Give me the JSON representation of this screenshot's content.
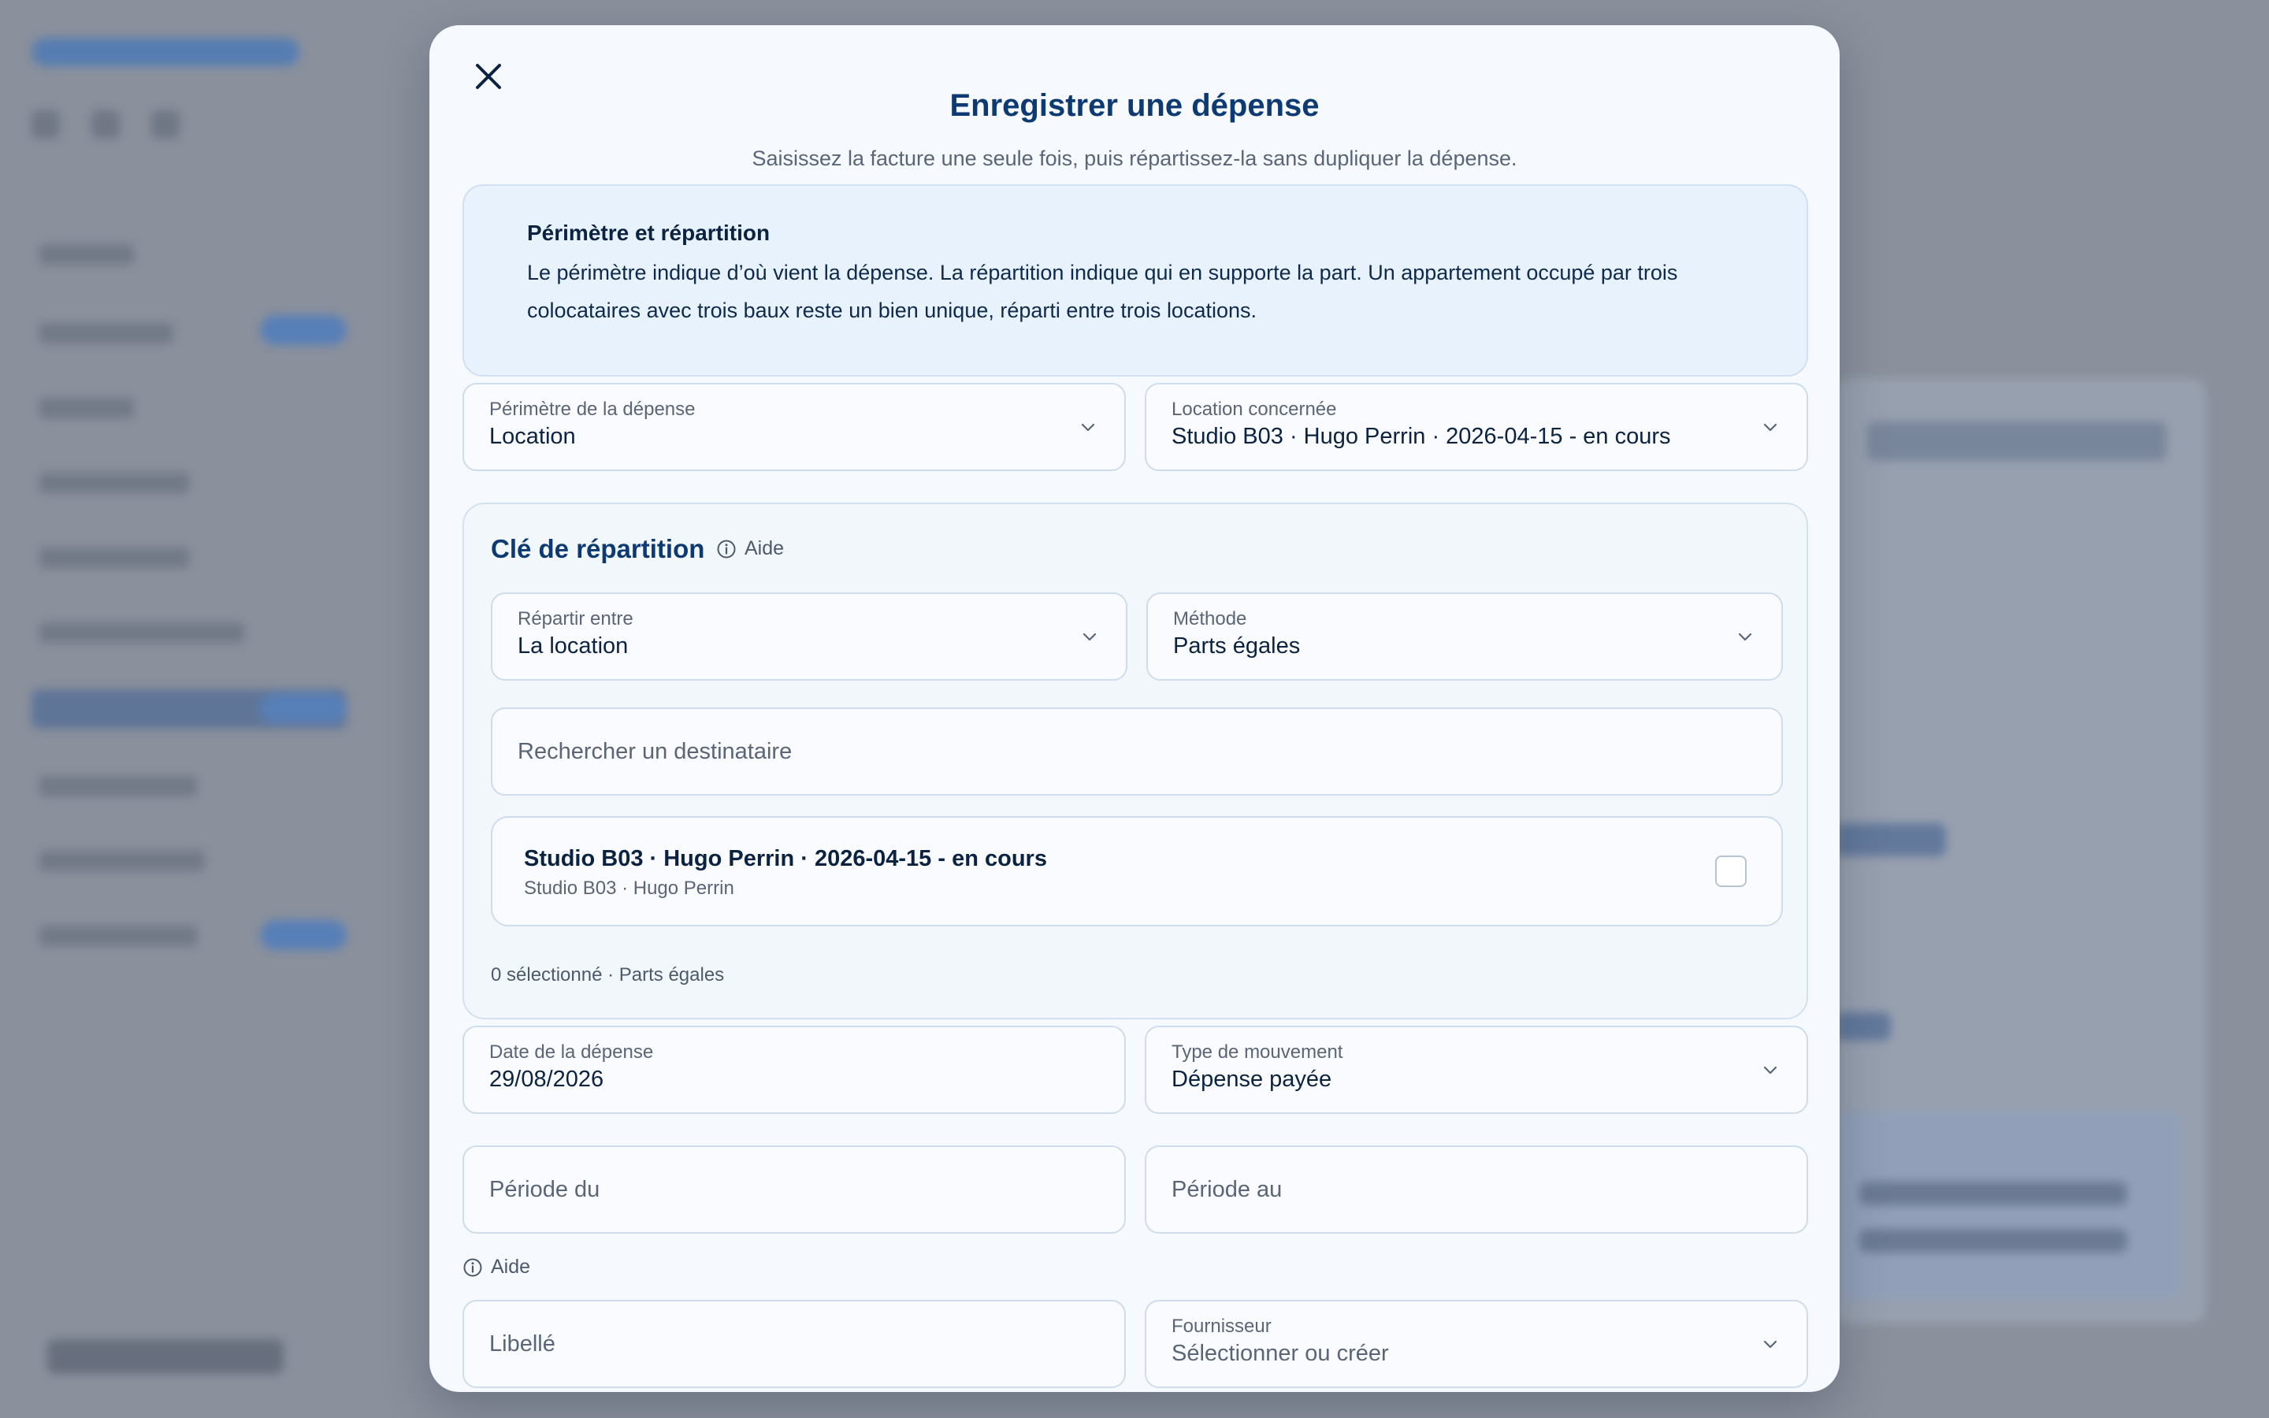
{
  "modal": {
    "title": "Enregistrer une dépense",
    "subtitle": "Saisissez la facture une seule fois, puis répartissez-la sans dupliquer la dépense.",
    "info": {
      "title": "Périmètre et répartition",
      "text": "Le périmètre indique d’où vient la dépense. La répartition indique qui en supporte la part. Un appartement occupé par trois colocataires avec trois baux reste un bien unique, réparti entre trois locations."
    },
    "perimetre": {
      "label": "Périmètre de la dépense",
      "value": "Location"
    },
    "location": {
      "label": "Location concernée",
      "value": "Studio B03 · Hugo Perrin · 2026-04-15 - en cours"
    },
    "repartition": {
      "title": "Clé de répartition",
      "help_label": "Aide",
      "repartir": {
        "label": "Répartir entre",
        "value": "La location"
      },
      "methode": {
        "label": "Méthode",
        "value": "Parts égales"
      },
      "search_placeholder": "Rechercher un destinataire",
      "recipients": [
        {
          "name": "Studio B03 · Hugo Perrin · 2026-04-15 - en cours",
          "sub": "Studio B03 · Hugo Perrin",
          "checked": false
        }
      ],
      "status": "0 sélectionné · Parts égales"
    },
    "date": {
      "label": "Date de la dépense",
      "value": "29/08/2026"
    },
    "type_mouvement": {
      "label": "Type de mouvement",
      "value": "Dépense payée"
    },
    "periode_du": {
      "placeholder": "Période du"
    },
    "periode_au": {
      "placeholder": "Période au"
    },
    "periode_help": "Aide",
    "libelle": {
      "placeholder": "Libellé"
    },
    "fournisseur": {
      "label": "Fournisseur",
      "placeholder": "Sélectionner ou créer"
    }
  },
  "colors": {
    "title": "#0d3a72",
    "info_bg": "#e8f2fc",
    "backdrop": "#8a909c",
    "accent": "#2f72cf"
  },
  "icons": [
    "close-icon",
    "chevron-down-icon",
    "info-icon"
  ]
}
